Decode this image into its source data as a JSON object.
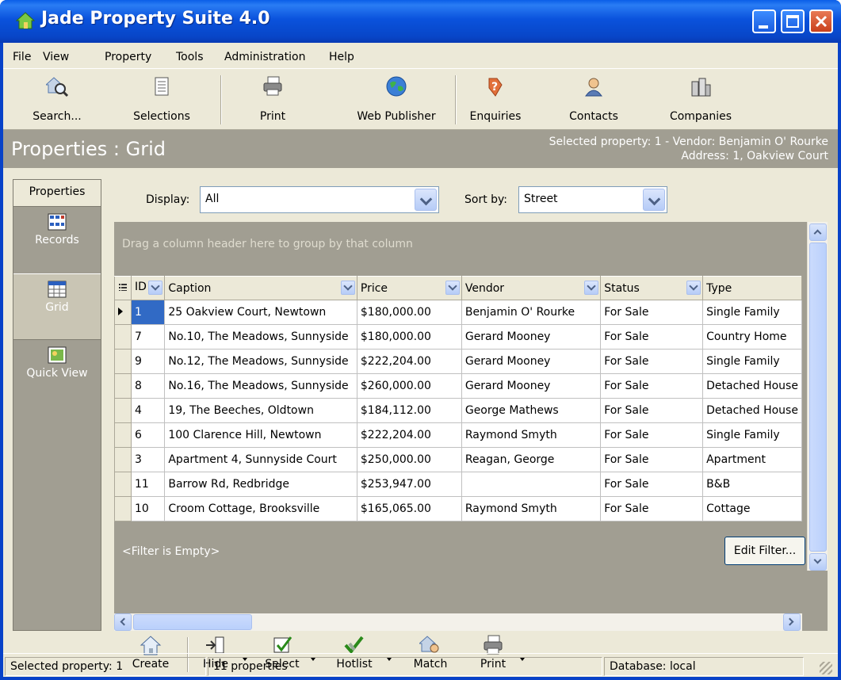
{
  "window": {
    "title": "Jade Property Suite 4.0"
  },
  "menu": [
    "File",
    "View",
    "Property",
    "Tools",
    "Administration",
    "Help"
  ],
  "toolbar": [
    {
      "label": "Search...",
      "icon": "search-house-icon"
    },
    {
      "label": "Selections",
      "icon": "selections-icon"
    },
    {
      "label": "Print",
      "icon": "printer-icon"
    },
    {
      "label": "Web Publisher",
      "icon": "globe-icon"
    },
    {
      "label": "Enquiries",
      "icon": "enquiries-icon"
    },
    {
      "label": "Contacts",
      "icon": "contacts-icon"
    },
    {
      "label": "Companies",
      "icon": "companies-icon"
    }
  ],
  "header": {
    "title": "Properties : Grid",
    "selected_line1": "Selected property: 1 - Vendor: Benjamin O' Rourke",
    "selected_line2": "Address: 1, Oakview Court"
  },
  "sidebar": {
    "heading": "Properties",
    "items": [
      {
        "label": "Records",
        "icon": "records-icon"
      },
      {
        "label": "Grid",
        "icon": "grid-icon"
      },
      {
        "label": "Quick View",
        "icon": "quick-view-icon"
      }
    ]
  },
  "filters": {
    "display_label": "Display:",
    "display_value": "All",
    "sort_label": "Sort by:",
    "sort_value": "Street"
  },
  "grid": {
    "group_hint": "Drag a column header here to group by that column",
    "columns": [
      "ID",
      "Caption",
      "Price",
      "Vendor",
      "Status",
      "Type"
    ],
    "rows": [
      [
        "1",
        "25 Oakview Court, Newtown",
        "$180,000.00",
        "Benjamin O' Rourke",
        "For Sale",
        "Single Family"
      ],
      [
        "7",
        "No.10, The Meadows, Sunnyside",
        "$180,000.00",
        "Gerard Mooney",
        "For Sale",
        "Country Home"
      ],
      [
        "9",
        "No.12, The Meadows, Sunnyside",
        "$222,204.00",
        "Gerard Mooney",
        "For Sale",
        "Single Family"
      ],
      [
        "8",
        "No.16, The Meadows, Sunnyside",
        "$260,000.00",
        "Gerard Mooney",
        "For Sale",
        "Detached House"
      ],
      [
        "4",
        "19, The Beeches, Oldtown",
        "$184,112.00",
        "George Mathews",
        "For Sale",
        "Detached House"
      ],
      [
        "6",
        "100 Clarence Hill, Newtown",
        "$222,204.00",
        "Raymond Smyth",
        "For Sale",
        "Single Family"
      ],
      [
        "3",
        "Apartment 4, Sunnyside Court",
        "$250,000.00",
        "Reagan, George",
        "For Sale",
        "Apartment"
      ],
      [
        "11",
        "Barrow Rd, Redbridge",
        "$253,947.00",
        "",
        "For Sale",
        "B&B"
      ],
      [
        "10",
        "Croom Cottage, Brooksville",
        "$165,065.00",
        "Raymond Smyth",
        "For Sale",
        "Cottage"
      ]
    ],
    "filter_text": "<Filter is Empty>",
    "edit_filter_label": "Edit Filter..."
  },
  "actions": [
    {
      "label": "Create",
      "icon": "create-house-icon"
    },
    {
      "label": "Hide",
      "icon": "hide-icon"
    },
    {
      "label": "Select",
      "icon": "select-check-icon"
    },
    {
      "label": "Hotlist",
      "icon": "hotlist-icon"
    },
    {
      "label": "Match",
      "icon": "match-icon"
    },
    {
      "label": "Print",
      "icon": "printer-icon"
    }
  ],
  "status": {
    "selected": "Selected property: 1",
    "count": "11 properties",
    "database": "Database: local"
  }
}
